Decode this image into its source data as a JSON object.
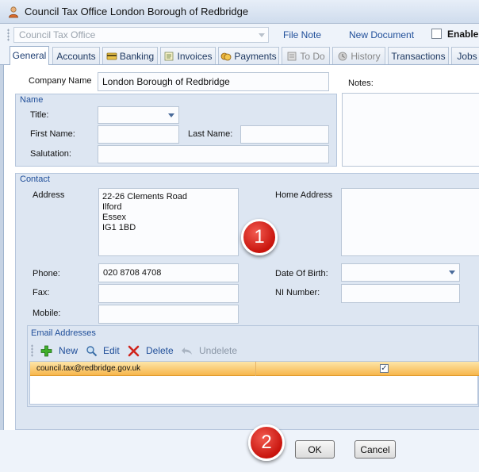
{
  "window": {
    "title": "Council Tax Office London Borough of Redbridge",
    "icon": "user-card-icon"
  },
  "toolbar": {
    "combo_value": "Council Tax Office",
    "file_note": "File Note",
    "new_document": "New Document",
    "enable_label": "Enable I"
  },
  "tabs": [
    {
      "label": "General",
      "icon": ""
    },
    {
      "label": "Accounts",
      "icon": ""
    },
    {
      "label": "Banking",
      "icon": "credit-card-icon"
    },
    {
      "label": "Invoices",
      "icon": "invoice-icon"
    },
    {
      "label": "Payments",
      "icon": "coins-icon"
    },
    {
      "label": "To Do",
      "icon": "todo-icon"
    },
    {
      "label": "History",
      "icon": "history-icon"
    },
    {
      "label": "Transactions",
      "icon": ""
    },
    {
      "label": "Jobs",
      "icon": ""
    }
  ],
  "general": {
    "company_name_label": "Company Name",
    "company_name_value": "London Borough of Redbridge",
    "notes_label": "Notes:",
    "name_group": {
      "title": "Name",
      "title_label": "Title:",
      "first_name_label": "First Name:",
      "last_name_label": "Last Name:",
      "salutation_label": "Salutation:"
    },
    "contact_group": {
      "title": "Contact",
      "address_label": "Address",
      "address_lines": "22-26 Clements Road\nIlford\nEssex\nIG1 1BD",
      "home_address_label": "Home Address",
      "phone_label": "Phone:",
      "phone_value": "020 8708 4708",
      "dob_label": "Date Of Birth:",
      "fax_label": "Fax:",
      "ni_label": "NI Number:",
      "mobile_label": "Mobile:"
    },
    "email_group": {
      "title": "Email Addresses",
      "new_label": "New",
      "edit_label": "Edit",
      "delete_label": "Delete",
      "undelete_label": "Undelete",
      "rows": [
        {
          "email": "council.tax@redbridge.gov.uk",
          "checked": true
        }
      ]
    }
  },
  "buttons": {
    "ok": "OK",
    "cancel": "Cancel"
  },
  "callouts": {
    "one": "1",
    "two": "2"
  },
  "colors": {
    "accent_blue": "#1f4e99",
    "selected_row": "#f7b64c",
    "callout_red": "#d8231a"
  }
}
